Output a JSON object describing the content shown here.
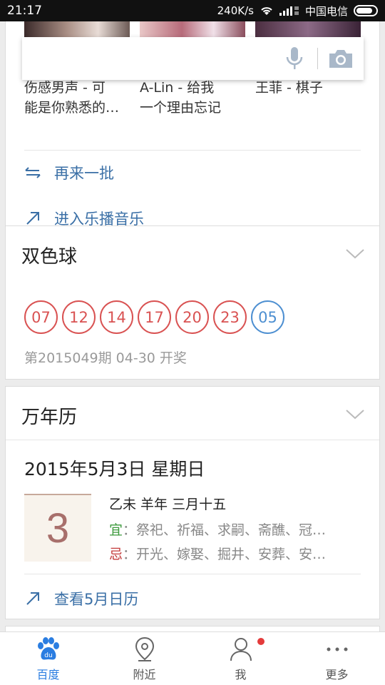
{
  "status_bar": {
    "time": "21:17",
    "speed": "240K/s",
    "carrier": "中国电信"
  },
  "music": {
    "songs": [
      {
        "line1": "伤感男声 - 可",
        "line2": "能是你熟悉的…"
      },
      {
        "line1": "A-Lin - 给我",
        "line2": "一个理由忘记"
      },
      {
        "line1": "王菲 - 棋子",
        "line2": ""
      }
    ],
    "refresh_label": "再来一批",
    "enter_label": "进入乐播音乐"
  },
  "search": {
    "placeholder": ""
  },
  "lottery": {
    "title": "双色球",
    "red_balls": [
      "07",
      "12",
      "14",
      "17",
      "20",
      "23"
    ],
    "blue_ball": "05",
    "info": "第2015049期 04-30 开奖"
  },
  "calendar": {
    "title": "万年历",
    "date": "2015年5月3日 星期日",
    "day": "3",
    "lunar": "乙未 羊年 三月十五",
    "yi_label": "宜",
    "yi_text": "：祭祀、祈福、求嗣、斋醮、冠…",
    "ji_label": "忌",
    "ji_text": "：开光、嫁娶、掘井、安葬、安…",
    "link_label": "查看5月日历"
  },
  "bottom_nav": {
    "items": [
      {
        "label": "百度",
        "icon": "baidu-paw-icon"
      },
      {
        "label": "附近",
        "icon": "location-pin-icon"
      },
      {
        "label": "我",
        "icon": "person-icon"
      },
      {
        "label": "更多",
        "icon": "more-dots-icon"
      }
    ]
  },
  "colors": {
    "accent_blue": "#2a7de1",
    "link_blue": "#3a6fa6",
    "ball_red": "#d95252",
    "ball_blue": "#4d8fd1",
    "yi_green": "#3c9a3c",
    "ji_red": "#c33a3a"
  }
}
